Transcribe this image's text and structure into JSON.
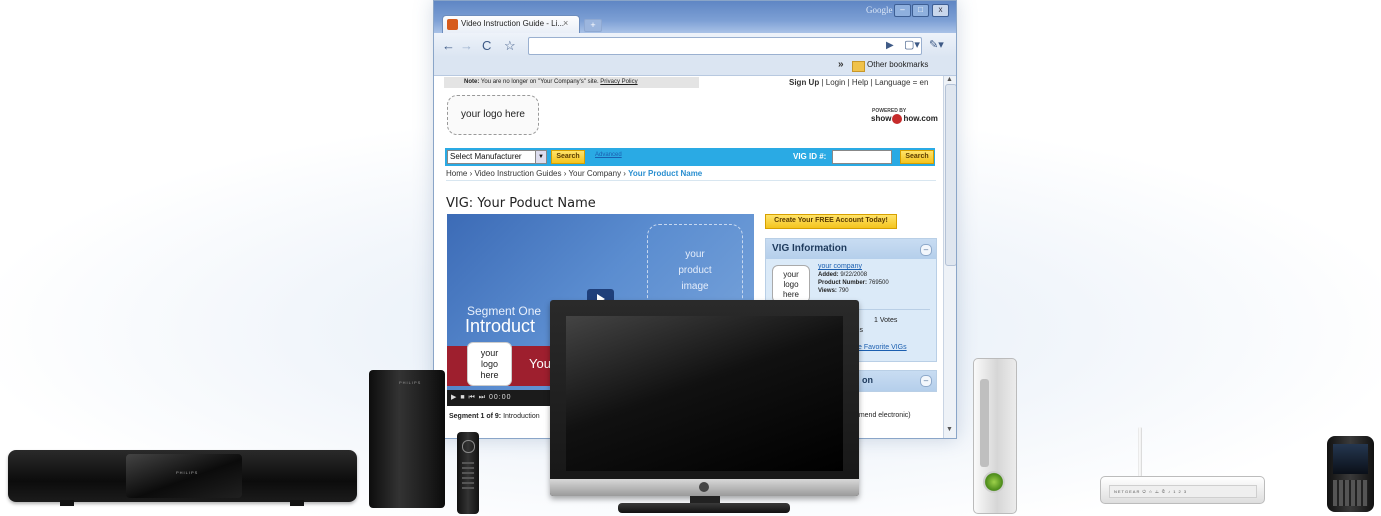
{
  "browser": {
    "tab_title": "Video Instruction Guide - Li...",
    "tab_close": "×",
    "new_tab": "+",
    "window_label": "Google",
    "bookmarks_chevron": "»",
    "other_bookmarks": "Other bookmarks"
  },
  "page": {
    "note_label": "Note:",
    "note_text": " You are no longer on \"Your Company's\" site. ",
    "privacy_policy": "Privacy Policy",
    "sign_up": "Sign Up",
    "top_links": " | Login | Help | Language = en",
    "logo_placeholder": "your logo here",
    "powered_by": "POWERED BY",
    "powered_brand_left": "show",
    "powered_brand_right": "how.com",
    "manufacturer_select": "Select Manufacturer",
    "search_label": "Search",
    "advanced_link": "Advanced",
    "vig_id_label": "VIG ID #:",
    "vig_id_value": "",
    "breadcrumb": {
      "home": "Home",
      "guides": "Video Instruction Guides",
      "company": "Your Company",
      "current": "Your Product Name"
    },
    "vig_title": "VIG: Your Poduct Name",
    "player": {
      "product_image_text": [
        "your",
        "product",
        "image"
      ],
      "segment_heading": "Segment One",
      "intro_heading": "Introduct",
      "logo_lines": [
        "your",
        "logo",
        "here"
      ],
      "you_text": "You",
      "time_readout": "00:00"
    },
    "segment_line_bold": "Segment 1 of 9:",
    "segment_line_text": " Introduction",
    "create_account": "Create Your FREE Account Today!",
    "vig_info": {
      "title": "VIG Information",
      "logo_lines": [
        "your",
        "logo",
        "here"
      ],
      "company_link": "your company",
      "added_label": "Added:",
      "added_value": " 9/22/2008",
      "product_number_label": "Product Number:",
      "product_number_value": " 769500",
      "views_label": "Views:",
      "views_value": " 790",
      "votes": "1 Votes",
      "vigs_fragment": "Gs",
      "favorite_link": "e Favorite VIGs"
    },
    "panel2_fragment": "on",
    "recommend_fragment": "mmend electronic)"
  },
  "devices": {
    "soundbar_brand": "PHILIPS",
    "subwoofer_brand": "PHILIPS",
    "router_panel": "NETGEAR  ⏻ ☆ ⚠ ✆ ♪   1  2  3"
  },
  "colors": {
    "accent_blue": "#2aaae4",
    "button_yellow": "#f4c41e",
    "red_band": "#9e1f2e",
    "panel_bg": "#dbeaf8"
  }
}
